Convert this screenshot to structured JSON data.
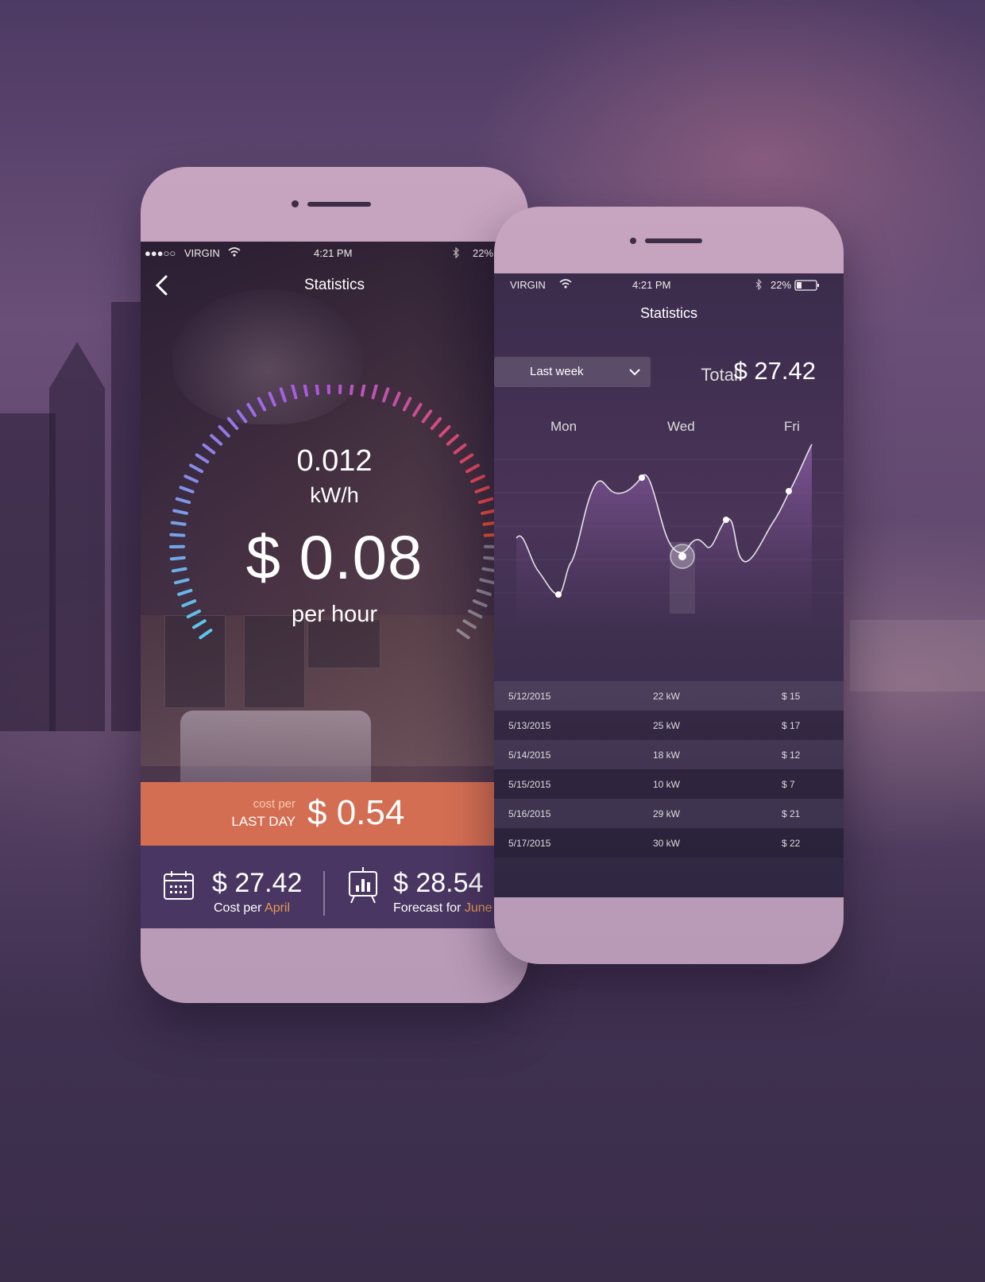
{
  "phone_left": {
    "status": {
      "carrier": "VIRGIN",
      "time": "4:21 PM",
      "battery": "22%"
    },
    "title": "Statistics",
    "gauge": {
      "kwh_value": "0.012",
      "kwh_unit": "kW/h",
      "cost": "$ 0.08",
      "cost_unit": "per hour",
      "level": 0.6
    },
    "last_day": {
      "small": "cost per",
      "big": "LAST DAY",
      "value": "$ 0.54"
    },
    "summary": [
      {
        "value": "$ 27.42",
        "label": "Cost per",
        "accent": "April"
      },
      {
        "value": "$ 28.54",
        "label": "Forecast for",
        "accent": "June"
      }
    ]
  },
  "phone_right": {
    "status": {
      "carrier": "VIRGIN",
      "time": "4:21 PM",
      "battery": "22%"
    },
    "title": "Statistics",
    "period": "Last week",
    "total_label": "Total:",
    "total_value": "$ 27.42",
    "days": [
      "Mon",
      "Wed",
      "Fri"
    ],
    "rows": [
      {
        "date": "5/12/2015",
        "kw": "22 kW",
        "cost": "$ 15"
      },
      {
        "date": "5/13/2015",
        "kw": "25 kW",
        "cost": "$ 17"
      },
      {
        "date": "5/14/2015",
        "kw": "18 kW",
        "cost": "$ 12"
      },
      {
        "date": "5/15/2015",
        "kw": "10 kW",
        "cost": "$ 7"
      },
      {
        "date": "5/16/2015",
        "kw": "29 kW",
        "cost": "$ 21"
      },
      {
        "date": "5/17/2015",
        "kw": "30 kW",
        "cost": "$ 22"
      }
    ]
  },
  "colors": {
    "accent": "#e69a52",
    "orange_bar": "#d46e52",
    "purple_strip": "#4a3662"
  }
}
